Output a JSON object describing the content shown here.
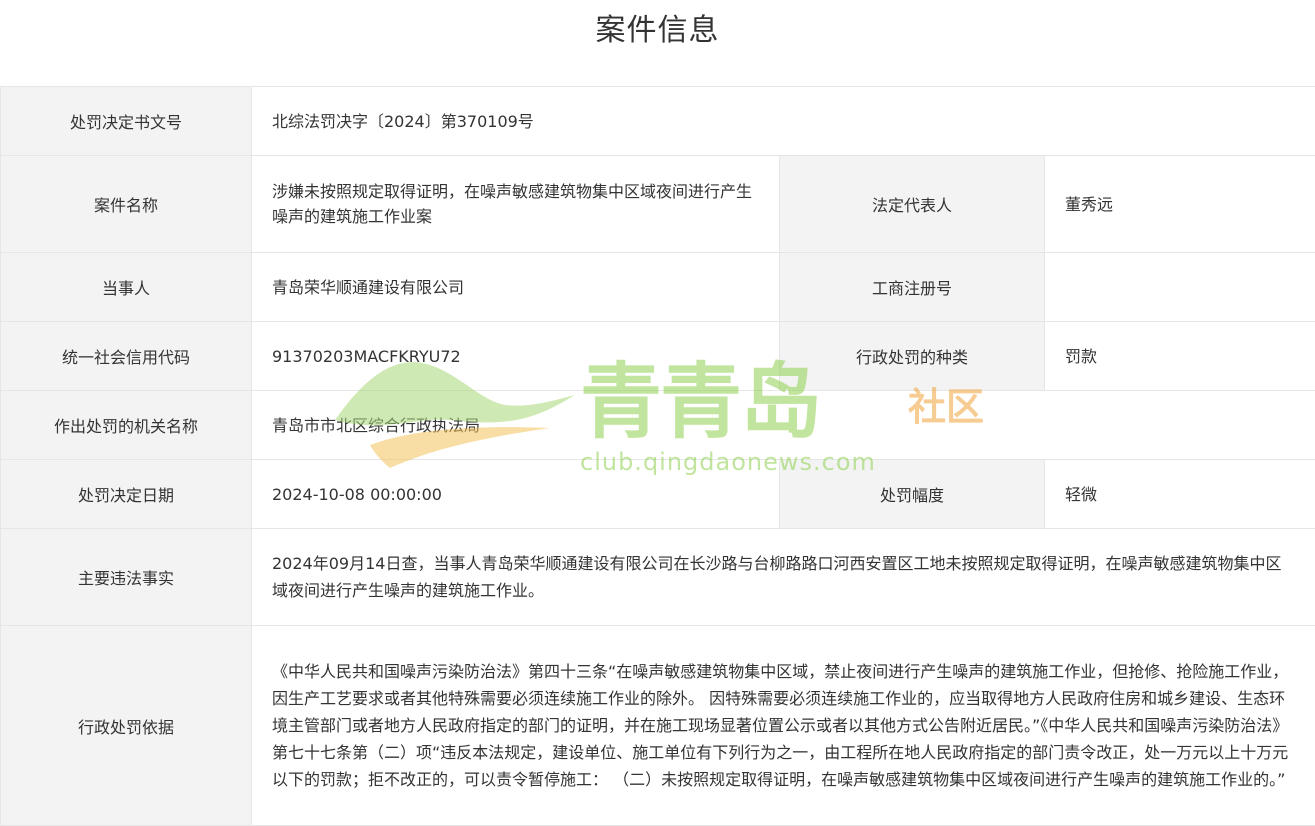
{
  "page": {
    "title": "案件信息"
  },
  "rows": {
    "decision_no": {
      "label": "处罚决定书文号",
      "value": "北综法罚决字〔2024〕第370109号"
    },
    "case_name": {
      "label": "案件名称",
      "value": "涉嫌未按照规定取得证明，在噪声敏感建筑物集中区域夜间进行产生噪声的建筑施工作业案"
    },
    "legal_rep": {
      "label": "法定代表人",
      "value": "董秀远"
    },
    "party": {
      "label": "当事人",
      "value": "青岛荣华顺通建设有限公司"
    },
    "biz_reg_no": {
      "label": "工商注册号",
      "value": ""
    },
    "credit_code": {
      "label": "统一社会信用代码",
      "value": "91370203MACFKRYU72"
    },
    "penalty_type": {
      "label": "行政处罚的种类",
      "value": "罚款"
    },
    "authority": {
      "label": "作出处罚的机关名称",
      "value": "青岛市市北区综合行政执法局"
    },
    "decision_date": {
      "label": "处罚决定日期",
      "value": "2024-10-08 00:00:00"
    },
    "penalty_degree": {
      "label": "处罚幅度",
      "value": "轻微"
    },
    "facts": {
      "label": "主要违法事实",
      "value": "2024年09月14日查，当事人青岛荣华顺通建设有限公司在长沙路与台柳路路口河西安置区工地未按照规定取得证明，在噪声敏感建筑物集中区域夜间进行产生噪声的建筑施工作业。"
    },
    "basis": {
      "label": "行政处罚依据",
      "value": "《中华人民共和国噪声污染防治法》第四十三条“在噪声敏感建筑物集中区域，禁止夜间进行产生噪声的建筑施工作业，但抢修、抢险施工作业，因生产工艺要求或者其他特殊需要必须连续施工作业的除外。 因特殊需要必须连续施工作业的，应当取得地方人民政府住房和城乡建设、生态环境主管部门或者地方人民政府指定的部门的证明，并在施工现场显著位置公示或者以其他方式公告附近居民。”《中华人民共和国噪声污染防治法》第七十七条第（二）项“违反本法规定，建设单位、施工单位有下列行为之一，由工程所在地人民政府指定的部门责令改正，处一万元以上十万元以下的罚款；拒不改正的，可以责令暂停施工：  （二）未按照规定取得证明，在噪声敏感建筑物集中区域夜间进行产生噪声的建筑施工作业的。”"
    }
  },
  "watermark": {
    "brand": "青青岛",
    "tag": "社区",
    "url": "club.qingdaonews.com"
  }
}
